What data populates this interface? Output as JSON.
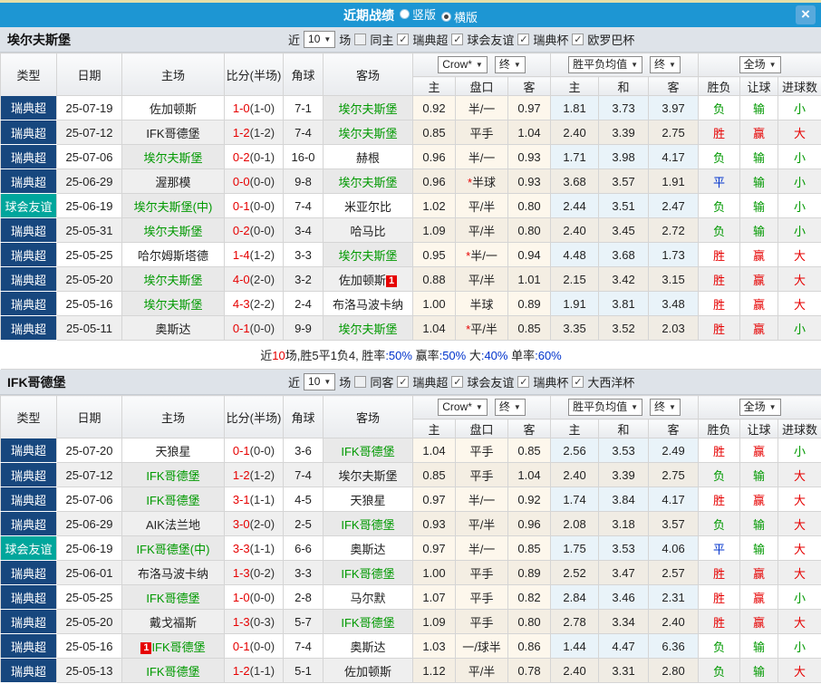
{
  "titlebar": {
    "title": "近期战绩",
    "radios": [
      {
        "label": "竖版",
        "selected": false
      },
      {
        "label": "横版",
        "selected": true
      }
    ],
    "close": "×"
  },
  "table_headers": {
    "main": [
      "类型",
      "日期",
      "主场",
      "比分(半场)",
      "角球",
      "客场"
    ],
    "sub": [
      "主",
      "盘口",
      "客",
      "主",
      "和",
      "客",
      "胜负",
      "让球",
      "进球数"
    ],
    "dd_company": "Crow*",
    "dd_final": "终",
    "dd_avg": "胜平负均值",
    "dd_scope": "全场"
  },
  "result_colors": {
    "胜": "red",
    "赢": "red",
    "大": "red",
    "负": "green",
    "输": "green",
    "小": "green",
    "平": "blue"
  },
  "colors": {
    "titlebar": "#1d96d3",
    "league_badge": "#17477e",
    "friendly_badge": "#00a69c",
    "team_highlight": "#009900",
    "win": "#e60000",
    "lose": "#009900",
    "draw": "#0033cc"
  },
  "sections": [
    {
      "team": "埃尔夫斯堡",
      "filter": {
        "near": "近",
        "count": "10",
        "games": "场",
        "same": {
          "label": "同主",
          "checked": false
        },
        "leagues": [
          {
            "label": "瑞典超",
            "checked": true
          },
          {
            "label": "球会友谊",
            "checked": true
          },
          {
            "label": "瑞典杯",
            "checked": true
          },
          {
            "label": "欧罗巴杯",
            "checked": true
          }
        ]
      },
      "rows": [
        {
          "league": "瑞典超",
          "kind": "league",
          "date": "25-07-19",
          "home": {
            "name": "佐加顿斯",
            "hl": false
          },
          "ft": "1-0",
          "ht": "(1-0)",
          "corner": "7-1",
          "away": {
            "name": "埃尔夫斯堡",
            "hl": true
          },
          "crow": [
            "0.92",
            "半/一",
            "0.97"
          ],
          "star": false,
          "avg": [
            "1.81",
            "3.73",
            "3.97"
          ],
          "res": [
            "负",
            "输",
            "小"
          ]
        },
        {
          "league": "瑞典超",
          "kind": "league",
          "date": "25-07-12",
          "home": {
            "name": "IFK哥德堡",
            "hl": false
          },
          "ft": "1-2",
          "ht": "(1-2)",
          "corner": "7-4",
          "away": {
            "name": "埃尔夫斯堡",
            "hl": true
          },
          "crow": [
            "0.85",
            "平手",
            "1.04"
          ],
          "star": false,
          "avg": [
            "2.40",
            "3.39",
            "2.75"
          ],
          "res": [
            "胜",
            "赢",
            "大"
          ]
        },
        {
          "league": "瑞典超",
          "kind": "league",
          "date": "25-07-06",
          "home": {
            "name": "埃尔夫斯堡",
            "hl": true
          },
          "ft": "0-2",
          "ht": "(0-1)",
          "corner": "16-0",
          "away": {
            "name": "赫根",
            "hl": false
          },
          "crow": [
            "0.96",
            "半/一",
            "0.93"
          ],
          "star": false,
          "avg": [
            "1.71",
            "3.98",
            "4.17"
          ],
          "res": [
            "负",
            "输",
            "小"
          ]
        },
        {
          "league": "瑞典超",
          "kind": "league",
          "date": "25-06-29",
          "home": {
            "name": "渥那模",
            "hl": false
          },
          "ft": "0-0",
          "ht": "(0-0)",
          "corner": "9-8",
          "away": {
            "name": "埃尔夫斯堡",
            "hl": true
          },
          "crow": [
            "0.96",
            "半球",
            "0.93"
          ],
          "star": true,
          "avg": [
            "3.68",
            "3.57",
            "1.91"
          ],
          "res": [
            "平",
            "输",
            "小"
          ]
        },
        {
          "league": "球会友谊",
          "kind": "friendly",
          "date": "25-06-19",
          "home": {
            "name": "埃尔夫斯堡(中)",
            "hl": true
          },
          "ft": "0-1",
          "ht": "(0-0)",
          "corner": "7-4",
          "away": {
            "name": "米亚尔比",
            "hl": false
          },
          "crow": [
            "1.02",
            "平/半",
            "0.80"
          ],
          "star": false,
          "avg": [
            "2.44",
            "3.51",
            "2.47"
          ],
          "res": [
            "负",
            "输",
            "小"
          ]
        },
        {
          "league": "瑞典超",
          "kind": "league",
          "date": "25-05-31",
          "home": {
            "name": "埃尔夫斯堡",
            "hl": true
          },
          "ft": "0-2",
          "ht": "(0-0)",
          "corner": "3-4",
          "away": {
            "name": "哈马比",
            "hl": false
          },
          "crow": [
            "1.09",
            "平/半",
            "0.80"
          ],
          "star": false,
          "avg": [
            "2.40",
            "3.45",
            "2.72"
          ],
          "res": [
            "负",
            "输",
            "小"
          ]
        },
        {
          "league": "瑞典超",
          "kind": "league",
          "date": "25-05-25",
          "home": {
            "name": "哈尔姆斯塔德",
            "hl": false
          },
          "ft": "1-4",
          "ht": "(1-2)",
          "corner": "3-3",
          "away": {
            "name": "埃尔夫斯堡",
            "hl": true
          },
          "crow": [
            "0.95",
            "半/一",
            "0.94"
          ],
          "star": true,
          "avg": [
            "4.48",
            "3.68",
            "1.73"
          ],
          "res": [
            "胜",
            "赢",
            "大"
          ]
        },
        {
          "league": "瑞典超",
          "kind": "league",
          "date": "25-05-20",
          "home": {
            "name": "埃尔夫斯堡",
            "hl": true
          },
          "ft": "4-0",
          "ht": "(2-0)",
          "corner": "3-2",
          "away": {
            "name": "佐加顿斯",
            "hl": false,
            "badge": "1",
            "badgePos": "after"
          },
          "crow": [
            "0.88",
            "平/半",
            "1.01"
          ],
          "star": false,
          "avg": [
            "2.15",
            "3.42",
            "3.15"
          ],
          "res": [
            "胜",
            "赢",
            "大"
          ]
        },
        {
          "league": "瑞典超",
          "kind": "league",
          "date": "25-05-16",
          "home": {
            "name": "埃尔夫斯堡",
            "hl": true
          },
          "ft": "4-3",
          "ht": "(2-2)",
          "corner": "2-4",
          "away": {
            "name": "布洛马波卡纳",
            "hl": false
          },
          "crow": [
            "1.00",
            "半球",
            "0.89"
          ],
          "star": false,
          "avg": [
            "1.91",
            "3.81",
            "3.48"
          ],
          "res": [
            "胜",
            "赢",
            "大"
          ]
        },
        {
          "league": "瑞典超",
          "kind": "league",
          "date": "25-05-11",
          "home": {
            "name": "奥斯达",
            "hl": false
          },
          "ft": "0-1",
          "ht": "(0-0)",
          "corner": "9-9",
          "away": {
            "name": "埃尔夫斯堡",
            "hl": true
          },
          "crow": [
            "1.04",
            "平/半",
            "0.85"
          ],
          "star": true,
          "avg": [
            "3.35",
            "3.52",
            "2.03"
          ],
          "res": [
            "胜",
            "赢",
            "小"
          ]
        }
      ],
      "summary": [
        {
          "t": "近",
          "c": ""
        },
        {
          "t": "10",
          "c": "red"
        },
        {
          "t": "场,胜5平1负4, ",
          "c": ""
        },
        {
          "t": "胜率",
          "c": ""
        },
        {
          "t": ":50%",
          "c": "blue"
        },
        {
          "t": " 赢率",
          "c": ""
        },
        {
          "t": ":50%",
          "c": "blue"
        },
        {
          "t": " 大",
          "c": ""
        },
        {
          "t": ":40%",
          "c": "blue"
        },
        {
          "t": " 单率",
          "c": ""
        },
        {
          "t": ":60%",
          "c": "blue"
        }
      ]
    },
    {
      "team": "IFK哥德堡",
      "filter": {
        "near": "近",
        "count": "10",
        "games": "场",
        "same": {
          "label": "同客",
          "checked": false
        },
        "leagues": [
          {
            "label": "瑞典超",
            "checked": true
          },
          {
            "label": "球会友谊",
            "checked": true
          },
          {
            "label": "瑞典杯",
            "checked": true
          },
          {
            "label": "大西洋杯",
            "checked": true
          }
        ]
      },
      "rows": [
        {
          "league": "瑞典超",
          "kind": "league",
          "date": "25-07-20",
          "home": {
            "name": "天狼星",
            "hl": false
          },
          "ft": "0-1",
          "ht": "(0-0)",
          "corner": "3-6",
          "away": {
            "name": "IFK哥德堡",
            "hl": true
          },
          "crow": [
            "1.04",
            "平手",
            "0.85"
          ],
          "star": false,
          "avg": [
            "2.56",
            "3.53",
            "2.49"
          ],
          "res": [
            "胜",
            "赢",
            "小"
          ]
        },
        {
          "league": "瑞典超",
          "kind": "league",
          "date": "25-07-12",
          "home": {
            "name": "IFK哥德堡",
            "hl": true
          },
          "ft": "1-2",
          "ht": "(1-2)",
          "corner": "7-4",
          "away": {
            "name": "埃尔夫斯堡",
            "hl": false
          },
          "crow": [
            "0.85",
            "平手",
            "1.04"
          ],
          "star": false,
          "avg": [
            "2.40",
            "3.39",
            "2.75"
          ],
          "res": [
            "负",
            "输",
            "大"
          ]
        },
        {
          "league": "瑞典超",
          "kind": "league",
          "date": "25-07-06",
          "home": {
            "name": "IFK哥德堡",
            "hl": true
          },
          "ft": "3-1",
          "ht": "(1-1)",
          "corner": "4-5",
          "away": {
            "name": "天狼星",
            "hl": false
          },
          "crow": [
            "0.97",
            "半/一",
            "0.92"
          ],
          "star": false,
          "avg": [
            "1.74",
            "3.84",
            "4.17"
          ],
          "res": [
            "胜",
            "赢",
            "大"
          ]
        },
        {
          "league": "瑞典超",
          "kind": "league",
          "date": "25-06-29",
          "home": {
            "name": "AIK法兰地",
            "hl": false
          },
          "ft": "3-0",
          "ht": "(2-0)",
          "corner": "2-5",
          "away": {
            "name": "IFK哥德堡",
            "hl": true
          },
          "crow": [
            "0.93",
            "平/半",
            "0.96"
          ],
          "star": false,
          "avg": [
            "2.08",
            "3.18",
            "3.57"
          ],
          "res": [
            "负",
            "输",
            "大"
          ]
        },
        {
          "league": "球会友谊",
          "kind": "friendly",
          "date": "25-06-19",
          "home": {
            "name": "IFK哥德堡(中)",
            "hl": true
          },
          "ft": "3-3",
          "ht": "(1-1)",
          "corner": "6-6",
          "away": {
            "name": "奥斯达",
            "hl": false
          },
          "crow": [
            "0.97",
            "半/一",
            "0.85"
          ],
          "star": false,
          "avg": [
            "1.75",
            "3.53",
            "4.06"
          ],
          "res": [
            "平",
            "输",
            "大"
          ]
        },
        {
          "league": "瑞典超",
          "kind": "league",
          "date": "25-06-01",
          "home": {
            "name": "布洛马波卡纳",
            "hl": false
          },
          "ft": "1-3",
          "ht": "(0-2)",
          "corner": "3-3",
          "away": {
            "name": "IFK哥德堡",
            "hl": true
          },
          "crow": [
            "1.00",
            "平手",
            "0.89"
          ],
          "star": false,
          "avg": [
            "2.52",
            "3.47",
            "2.57"
          ],
          "res": [
            "胜",
            "赢",
            "大"
          ]
        },
        {
          "league": "瑞典超",
          "kind": "league",
          "date": "25-05-25",
          "home": {
            "name": "IFK哥德堡",
            "hl": true
          },
          "ft": "1-0",
          "ht": "(0-0)",
          "corner": "2-8",
          "away": {
            "name": "马尔默",
            "hl": false
          },
          "crow": [
            "1.07",
            "平手",
            "0.82"
          ],
          "star": false,
          "avg": [
            "2.84",
            "3.46",
            "2.31"
          ],
          "res": [
            "胜",
            "赢",
            "小"
          ]
        },
        {
          "league": "瑞典超",
          "kind": "league",
          "date": "25-05-20",
          "home": {
            "name": "戴戈福斯",
            "hl": false
          },
          "ft": "1-3",
          "ht": "(0-3)",
          "corner": "5-7",
          "away": {
            "name": "IFK哥德堡",
            "hl": true
          },
          "crow": [
            "1.09",
            "平手",
            "0.80"
          ],
          "star": false,
          "avg": [
            "2.78",
            "3.34",
            "2.40"
          ],
          "res": [
            "胜",
            "赢",
            "大"
          ]
        },
        {
          "league": "瑞典超",
          "kind": "league",
          "date": "25-05-16",
          "home": {
            "name": "IFK哥德堡",
            "hl": true,
            "badge": "1",
            "badgePos": "before"
          },
          "ft": "0-1",
          "ht": "(0-0)",
          "corner": "7-4",
          "away": {
            "name": "奥斯达",
            "hl": false
          },
          "crow": [
            "1.03",
            "一/球半",
            "0.86"
          ],
          "star": false,
          "avg": [
            "1.44",
            "4.47",
            "6.36"
          ],
          "res": [
            "负",
            "输",
            "小"
          ]
        },
        {
          "league": "瑞典超",
          "kind": "league",
          "date": "25-05-13",
          "home": {
            "name": "IFK哥德堡",
            "hl": true
          },
          "ft": "1-2",
          "ht": "(1-1)",
          "corner": "5-1",
          "away": {
            "name": "佐加顿斯",
            "hl": false
          },
          "crow": [
            "1.12",
            "平/半",
            "0.78"
          ],
          "star": false,
          "avg": [
            "2.40",
            "3.31",
            "2.80"
          ],
          "res": [
            "负",
            "输",
            "大"
          ]
        }
      ],
      "summary": null
    }
  ]
}
